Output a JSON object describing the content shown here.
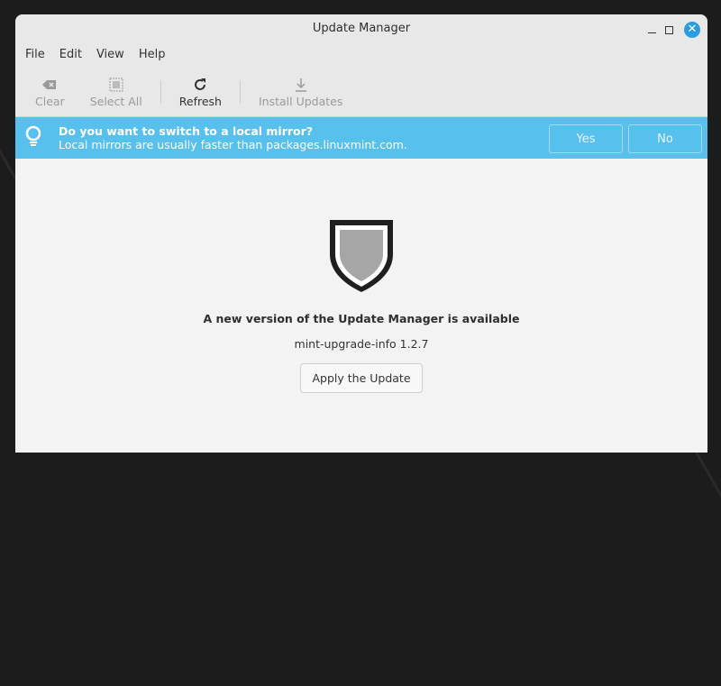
{
  "window": {
    "title": "Update Manager"
  },
  "menu": [
    "File",
    "Edit",
    "View",
    "Help"
  ],
  "toolbar": {
    "clear": "Clear",
    "select_all": "Select All",
    "refresh": "Refresh",
    "install": "Install Updates"
  },
  "infobar": {
    "title": "Do you want to switch to a local mirror?",
    "subtitle": "Local mirrors are usually faster than packages.linuxmint.com.",
    "yes": "Yes",
    "no": "No",
    "color": "#58c0ec"
  },
  "main": {
    "heading": "A new version of the Update Manager is available",
    "version": "mint-upgrade-info 1.2.7",
    "apply": "Apply the Update"
  }
}
